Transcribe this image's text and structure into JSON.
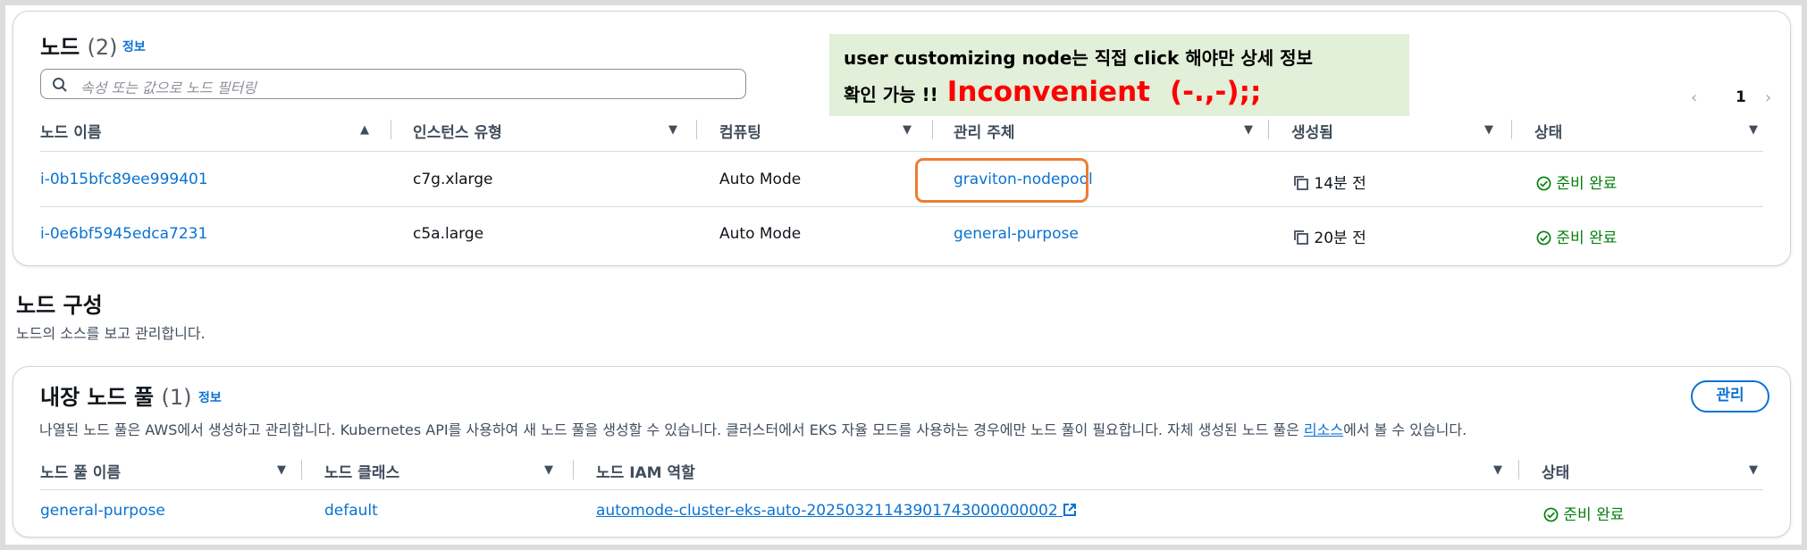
{
  "nodes_panel": {
    "title": "노드",
    "count": "(2)",
    "info_link": "정보",
    "search_placeholder": "속성 또는 값으로 노드 필터링",
    "pager": {
      "prev": "‹",
      "page": "1",
      "next": "›"
    },
    "columns": [
      "노드 이름",
      "인스턴스 유형",
      "컴퓨팅",
      "관리 주체",
      "생성됨",
      "상태"
    ],
    "rows": [
      {
        "name": "i-0b15bfc89ee999401",
        "instance_type": "c7g.xlarge",
        "compute": "Auto Mode",
        "managed_by": "graviton-nodepool",
        "created": "14분 전",
        "status": "준비 완료"
      },
      {
        "name": "i-0e6bf5945edca7231",
        "instance_type": "c5a.large",
        "compute": "Auto Mode",
        "managed_by": "general-purpose",
        "created": "20분 전",
        "status": "준비 완료"
      }
    ]
  },
  "annotation": {
    "line1": "user customizing node는 직접 click 해야만 상세 정보",
    "line2_prefix": "확인 가능 !!",
    "line2_big1": "Inconvenient",
    "line2_big2": "(-.,-);;"
  },
  "node_config": {
    "title": "노드 구성",
    "description": "노드의 소스를 보고 관리합니다."
  },
  "builtin_pools": {
    "title": "내장 노드 풀",
    "count": "(1)",
    "info_link": "정보",
    "manage_button": "관리",
    "description_prefix": "나열된 노드 풀은 AWS에서 생성하고 관리합니다. Kubernetes API를 사용하여 새 노드 풀을 생성할 수 있습니다. 클러스터에서 EKS 자율 모드를 사용하는 경우에만 노드 풀이 필요합니다. 자체 생성된 노드 풀은 ",
    "description_link": "리소스",
    "description_suffix": "에서 볼 수 있습니다.",
    "columns": [
      "노드 풀 이름",
      "노드 클래스",
      "노드 IAM 역할",
      "상태"
    ],
    "rows": [
      {
        "name": "general-purpose",
        "node_class": "default",
        "iam_role": "automode-cluster-eks-auto-20250321143901743000000002",
        "status": "준비 완료"
      }
    ]
  },
  "colors": {
    "link": "#0972d3",
    "success": "#037f0c",
    "highlight_border": "#ed7d31",
    "note_bg": "#e2efd9",
    "note_accent": "#ff0000"
  }
}
